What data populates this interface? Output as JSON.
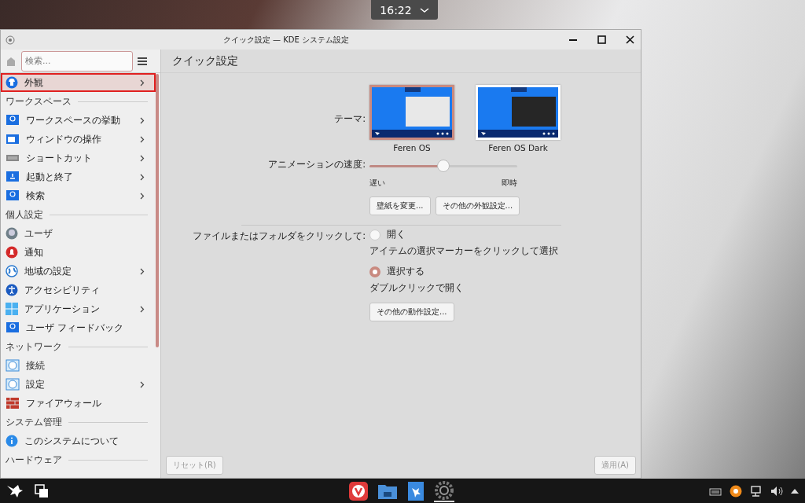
{
  "clock": {
    "time": "16:22"
  },
  "window": {
    "title": "クイック設定 — KDE システム設定"
  },
  "sidebar": {
    "search": {
      "placeholder": "検索..."
    },
    "top_item": {
      "label": "外観",
      "selected": true,
      "has_children": true
    },
    "groups": [
      {
        "title": "ワークスペース",
        "items": [
          {
            "label": "ワークスペースの挙動",
            "selected": false,
            "has_children": true
          },
          {
            "label": "ウィンドウの操作",
            "selected": false,
            "has_children": true
          },
          {
            "label": "ショートカット",
            "selected": false,
            "has_children": true
          },
          {
            "label": "起動と終了",
            "selected": false,
            "has_children": true
          },
          {
            "label": "検索",
            "selected": false,
            "has_children": true
          }
        ]
      },
      {
        "title": "個人設定",
        "items": [
          {
            "label": "ユーザ",
            "selected": false,
            "has_children": false
          },
          {
            "label": "通知",
            "selected": false,
            "has_children": false
          },
          {
            "label": "地域の設定",
            "selected": false,
            "has_children": true
          },
          {
            "label": "アクセシビリティ",
            "selected": false,
            "has_children": false
          },
          {
            "label": "アプリケーション",
            "selected": false,
            "has_children": true
          },
          {
            "label": "ユーザ フィードバック",
            "selected": false,
            "has_children": false
          }
        ]
      },
      {
        "title": "ネットワーク",
        "items": [
          {
            "label": "接続",
            "selected": false,
            "has_children": false
          },
          {
            "label": "設定",
            "selected": false,
            "has_children": true
          },
          {
            "label": "ファイアウォール",
            "selected": false,
            "has_children": false
          }
        ]
      },
      {
        "title": "システム管理",
        "items": [
          {
            "label": "このシステムについて",
            "selected": false,
            "has_children": false
          }
        ]
      },
      {
        "title": "ハードウェア"
      }
    ]
  },
  "page": {
    "title": "クイック設定",
    "theme": {
      "label": "テーマ:",
      "options": [
        {
          "name": "Feren OS",
          "kind": "light",
          "selected": true
        },
        {
          "name": "Feren OS Dark",
          "kind": "dark",
          "selected": false
        }
      ]
    },
    "animation": {
      "label": "アニメーションの速度:",
      "level": 0.5,
      "min_label": "遅い",
      "max_label": "即時"
    },
    "appearance_buttons": [
      "壁紙を変更...",
      "その他の外観設定..."
    ],
    "click": {
      "label": "ファイルまたはフォルダをクリックして:",
      "options": [
        {
          "label": "開く",
          "hint": "アイテムの選択マーカーをクリックして選択",
          "selected": false
        },
        {
          "label": "選択する",
          "hint": "ダブルクリックで開く",
          "selected": true
        }
      ]
    },
    "behavior_button": "その他の動作設定...",
    "reset_button": {
      "label": "リセット(R)",
      "disabled": true
    },
    "apply_button": {
      "label": "適用(A)",
      "disabled": true
    }
  }
}
